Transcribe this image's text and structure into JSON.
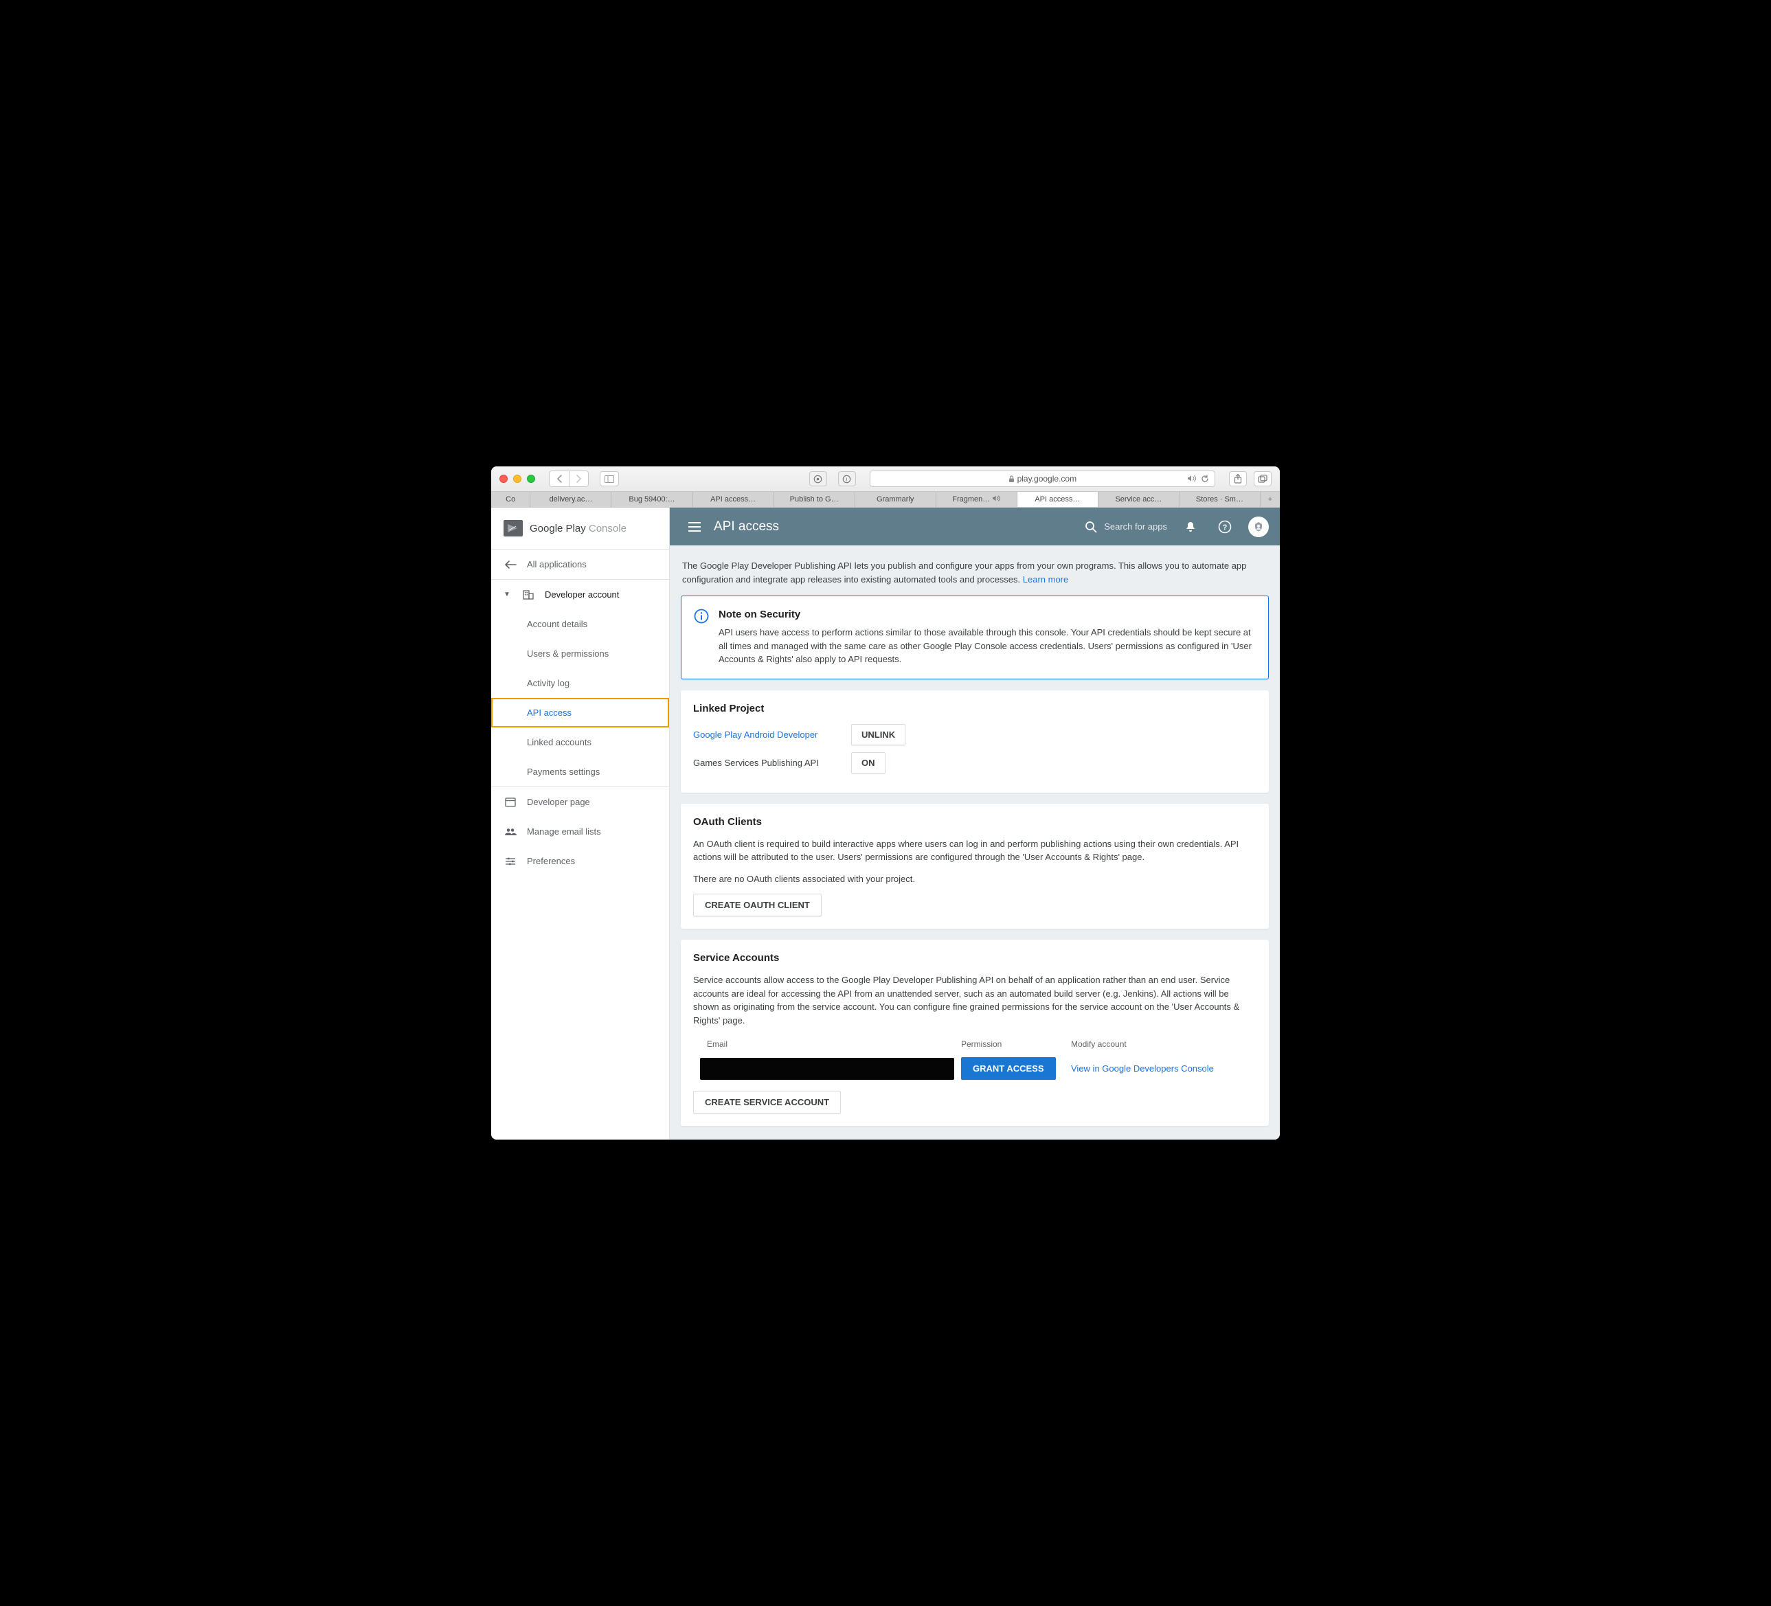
{
  "browser": {
    "url_host": "play.google.com",
    "tabs": [
      {
        "label": "Co"
      },
      {
        "label": "delivery.ac…"
      },
      {
        "label": "Bug 59400:…"
      },
      {
        "label": "API access…"
      },
      {
        "label": "Publish to G…"
      },
      {
        "label": "Grammarly"
      },
      {
        "label": "Fragmen…",
        "sound": true
      },
      {
        "label": "API access…",
        "active": true
      },
      {
        "label": "Service acc…"
      },
      {
        "label": "Stores · Sm…"
      }
    ]
  },
  "brand": {
    "g": "Google Play",
    "c": " Console"
  },
  "sidebar": {
    "all_applications": "All applications",
    "developer_account": "Developer account",
    "items": {
      "account_details": "Account details",
      "users_permissions": "Users & permissions",
      "activity_log": "Activity log",
      "api_access": "API access",
      "linked_accounts": "Linked accounts",
      "payments_settings": "Payments settings"
    },
    "developer_page": "Developer page",
    "manage_email_lists": "Manage email lists",
    "preferences": "Preferences"
  },
  "topbar": {
    "title": "API access",
    "search_placeholder": "Search for apps"
  },
  "intro": {
    "text": "The Google Play Developer Publishing API lets you publish and configure your apps from your own programs. This allows you to automate app configuration and integrate app releases into existing automated tools and processes. ",
    "learn_more": "Learn more"
  },
  "note": {
    "title": "Note on Security",
    "body": "API users have access to perform actions similar to those available through this console. Your API credentials should be kept secure at all times and managed with the same care as other Google Play Console access credentials. Users' permissions as configured in 'User Accounts & Rights' also apply to API requests."
  },
  "linked_project": {
    "title": "Linked Project",
    "project_link": "Google Play Android Developer",
    "unlink": "Unlink",
    "games_label": "Games Services Publishing API",
    "games_btn": "On"
  },
  "oauth": {
    "title": "OAuth Clients",
    "body": "An OAuth client is required to build interactive apps where users can log in and perform publishing actions using their own credentials. API actions will be attributed to the user. Users' permissions are configured through the 'User Accounts & Rights' page.",
    "empty": "There are no OAuth clients associated with your project.",
    "create": "Create OAuth Client"
  },
  "service": {
    "title": "Service Accounts",
    "body": "Service accounts allow access to the Google Play Developer Publishing API on behalf of an application rather than an end user. Service accounts are ideal for accessing the API from an unattended server, such as an automated build server (e.g. Jenkins). All actions will be shown as originating from the service account. You can configure fine grained permissions for the service account on the 'User Accounts & Rights' page.",
    "th_email": "Email",
    "th_perm": "Permission",
    "th_modify": "Modify account",
    "grant": "Grant Access",
    "view_link": "View in Google Developers Console",
    "create": "Create Service Account"
  }
}
